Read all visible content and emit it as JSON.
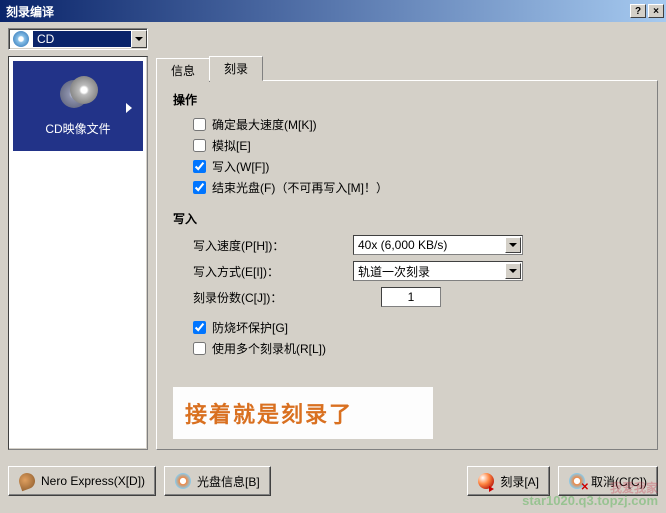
{
  "window": {
    "title": "刻录编译",
    "help_btn": "?",
    "close_btn": "×"
  },
  "device_combo": {
    "label": "CD"
  },
  "sidebar": {
    "item_label": "CD映像文件"
  },
  "tabs": {
    "info": "信息",
    "burn": "刻录"
  },
  "operation": {
    "title": "操作",
    "max_speed": {
      "label": "确定最大速度(M[K])",
      "checked": false
    },
    "simulate": {
      "label": "模拟[E]",
      "checked": false
    },
    "write": {
      "label": "写入(W[F])",
      "checked": true
    },
    "finalize": {
      "label": "结束光盘(F)（不可再写入[M]！）",
      "checked": true
    }
  },
  "writing": {
    "title": "写入",
    "speed_label": "写入速度(P[H])：",
    "speed_value": "40x (6,000 KB/s)",
    "method_label": "写入方式(E[I])：",
    "method_value": "轨道一次刻录",
    "copies_label": "刻录份数(C[J])：",
    "copies_value": "1",
    "buffer_protect": {
      "label": "防烧坏保护[G]",
      "checked": true
    },
    "multi_recorder": {
      "label": "使用多个刻录机(R[L])",
      "checked": false
    }
  },
  "annotation": "接着就是刻录了",
  "buttons": {
    "express": "Nero Express(X[D])",
    "disc_info": "光盘信息[B]",
    "burn": "刻录[A]",
    "cancel": "取消(C[C])"
  },
  "watermark": {
    "line1": "我爱我家",
    "line2": "star1020.q3.topzj.com"
  }
}
